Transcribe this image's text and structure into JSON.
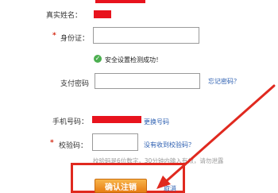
{
  "form": {
    "real_name_label": "真实姓名：",
    "id_card_label": "身份证：",
    "id_verify_success": "安全设置检测成功！",
    "pay_password_label": "支付密码",
    "forgot_password_link": "忘记密码？",
    "phone_label": "手机号码：",
    "change_number_link": "更换号码",
    "verify_code_label": "校验码：",
    "no_code_link": "没有收到校验码？",
    "code_note": "校验码是6位数字，30分钟内输入有效，请勿泄露",
    "confirm_button": "确认注销",
    "cancel_link": "取消"
  },
  "colors": {
    "accent_red": "#e0291f",
    "button_orange": "#f0961f",
    "link_blue": "#2a5db0",
    "success_green": "#4caf50"
  },
  "icons": [
    "success-check-icon"
  ]
}
